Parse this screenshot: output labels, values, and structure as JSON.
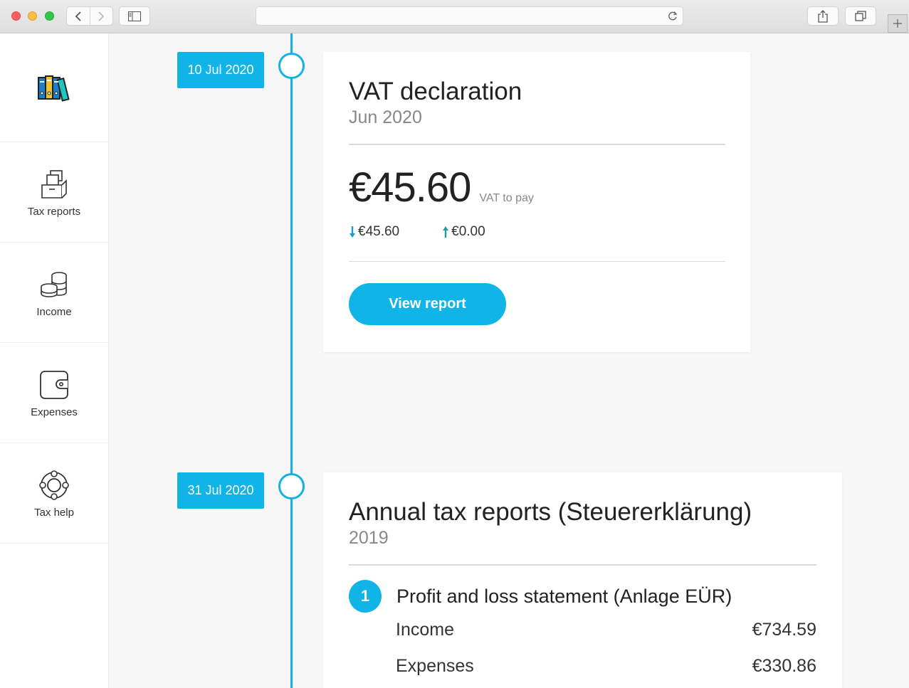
{
  "sidebar": {
    "items": [
      {
        "label": "Tax reports",
        "icon": "tax-reports-icon"
      },
      {
        "label": "Income",
        "icon": "coins-icon"
      },
      {
        "label": "Expenses",
        "icon": "wallet-icon"
      },
      {
        "label": "Tax help",
        "icon": "lifebuoy-icon"
      }
    ]
  },
  "timeline": {
    "entries": [
      {
        "date": "10 Jul 2020",
        "title": "VAT declaration",
        "period": "Jun 2020",
        "amount": "€45.60",
        "amount_label": "VAT to pay",
        "down_value": "€45.60",
        "up_value": "€0.00",
        "button_label": "View report"
      },
      {
        "date": "31 Jul 2020",
        "title": "Annual tax reports (Steuererklärung)",
        "period": "2019",
        "section": {
          "number": "1",
          "title": "Profit and loss statement (Anlage EÜR)",
          "rows": [
            {
              "label": "Income",
              "value": "€734.59"
            },
            {
              "label": "Expenses",
              "value": "€330.86"
            }
          ]
        }
      }
    ]
  },
  "colors": {
    "accent": "#10b4e6",
    "down_arrow": "#1a9bc6",
    "up_arrow": "#14a39a"
  }
}
